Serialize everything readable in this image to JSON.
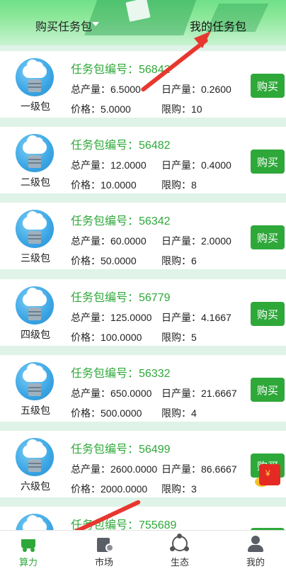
{
  "header": {
    "tab_buy": "购买任务包",
    "tab_mine": "我的任务包"
  },
  "labels": {
    "code_prefix": "任务包编号：",
    "total": "总产量：",
    "daily": "日产量：",
    "price": "价格：",
    "limit": "限购：",
    "buy": "购买"
  },
  "packages": [
    {
      "level": "一级包",
      "code": "任务包编号：56842",
      "total": "总产量：6.5000",
      "daily": "日产量：0.2600",
      "price": "价格：5.0000",
      "limit": "限购：10",
      "buy": "购买"
    },
    {
      "level": "二级包",
      "code": "任务包编号：56482",
      "total": "总产量：12.0000",
      "daily": "日产量：0.4000",
      "price": "价格：10.0000",
      "limit": "限购：8",
      "buy": "购买"
    },
    {
      "level": "三级包",
      "code": "任务包编号：56342",
      "total": "总产量：60.0000",
      "daily": "日产量：2.0000",
      "price": "价格：50.0000",
      "limit": "限购：6",
      "buy": "购买"
    },
    {
      "level": "四级包",
      "code": "任务包编号：56779",
      "total": "总产量：125.0000",
      "daily": "日产量：4.1667",
      "price": "价格：100.0000",
      "limit": "限购：5",
      "buy": "购买"
    },
    {
      "level": "五级包",
      "code": "任务包编号：56332",
      "total": "总产量：650.0000",
      "daily": "日产量：21.6667",
      "price": "价格：500.0000",
      "limit": "限购：4",
      "buy": "购买"
    },
    {
      "level": "六级包",
      "code": "任务包编号：56499",
      "total": "总产量：2600.0000",
      "daily": "日产量：86.6667",
      "price": "价格：2000.0000",
      "limit": "限购：3",
      "buy": "购买"
    },
    {
      "level": "",
      "code": "任务包编号：755689",
      "total": "",
      "daily": "",
      "price": "",
      "limit": "",
      "buy": ""
    }
  ],
  "tabbar": {
    "items": [
      {
        "label": "算力",
        "icon": "cart-icon",
        "active": true
      },
      {
        "label": "市场",
        "icon": "market-icon",
        "active": false
      },
      {
        "label": "生态",
        "icon": "ecology-icon",
        "active": false
      },
      {
        "label": "我的",
        "icon": "profile-icon",
        "active": false
      }
    ]
  },
  "colors": {
    "accent": "#2fa83a",
    "annotation_arrow": "#e8372f"
  }
}
